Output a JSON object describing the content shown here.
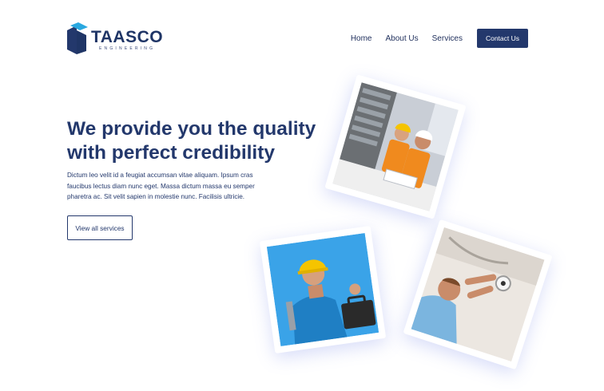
{
  "brand": {
    "name": "TAASCO",
    "tagline": "ENGINEERING",
    "colors": {
      "primary": "#23386c",
      "accent": "#29a8e0"
    }
  },
  "nav": {
    "links": [
      "Home",
      "About Us",
      "Services"
    ],
    "cta_label": "Contact Us"
  },
  "hero": {
    "title": "We provide you the quality with perfect credibility",
    "text": "Dictum leo velit id a feugiat accumsan vitae aliquam. Ipsum cras faucibus lectus diam nunc eget. Massa dictum massa eu semper pharetra ac. Sit velit sapien in molestie nunc. Facilisis ultricie.",
    "button_label": "View all services"
  },
  "gallery": [
    {
      "icon": "engineers-on-site-photo"
    },
    {
      "icon": "technician-with-tools-photo"
    },
    {
      "icon": "electrician-installing-camera-photo"
    }
  ]
}
